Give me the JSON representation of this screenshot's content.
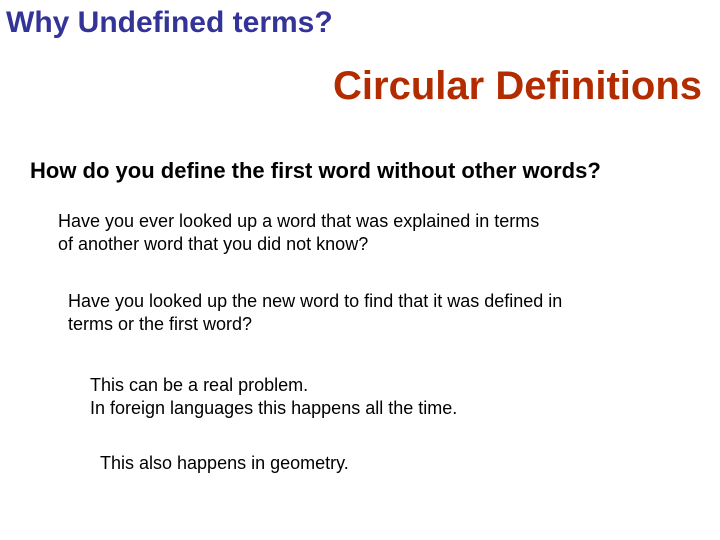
{
  "heading": "Why Undefined terms?",
  "subtitle": "Circular Definitions",
  "question": "How do you define the first word without other words?",
  "p1": "Have you ever looked up a word that was explained in terms of another word that you did not know?",
  "p2": "Have you looked up the new word to find that it was defined in terms or the first word?",
  "p3a": "This can be a real problem.",
  "p3b": "In foreign languages this happens all the time.",
  "p4": "This also happens in geometry."
}
